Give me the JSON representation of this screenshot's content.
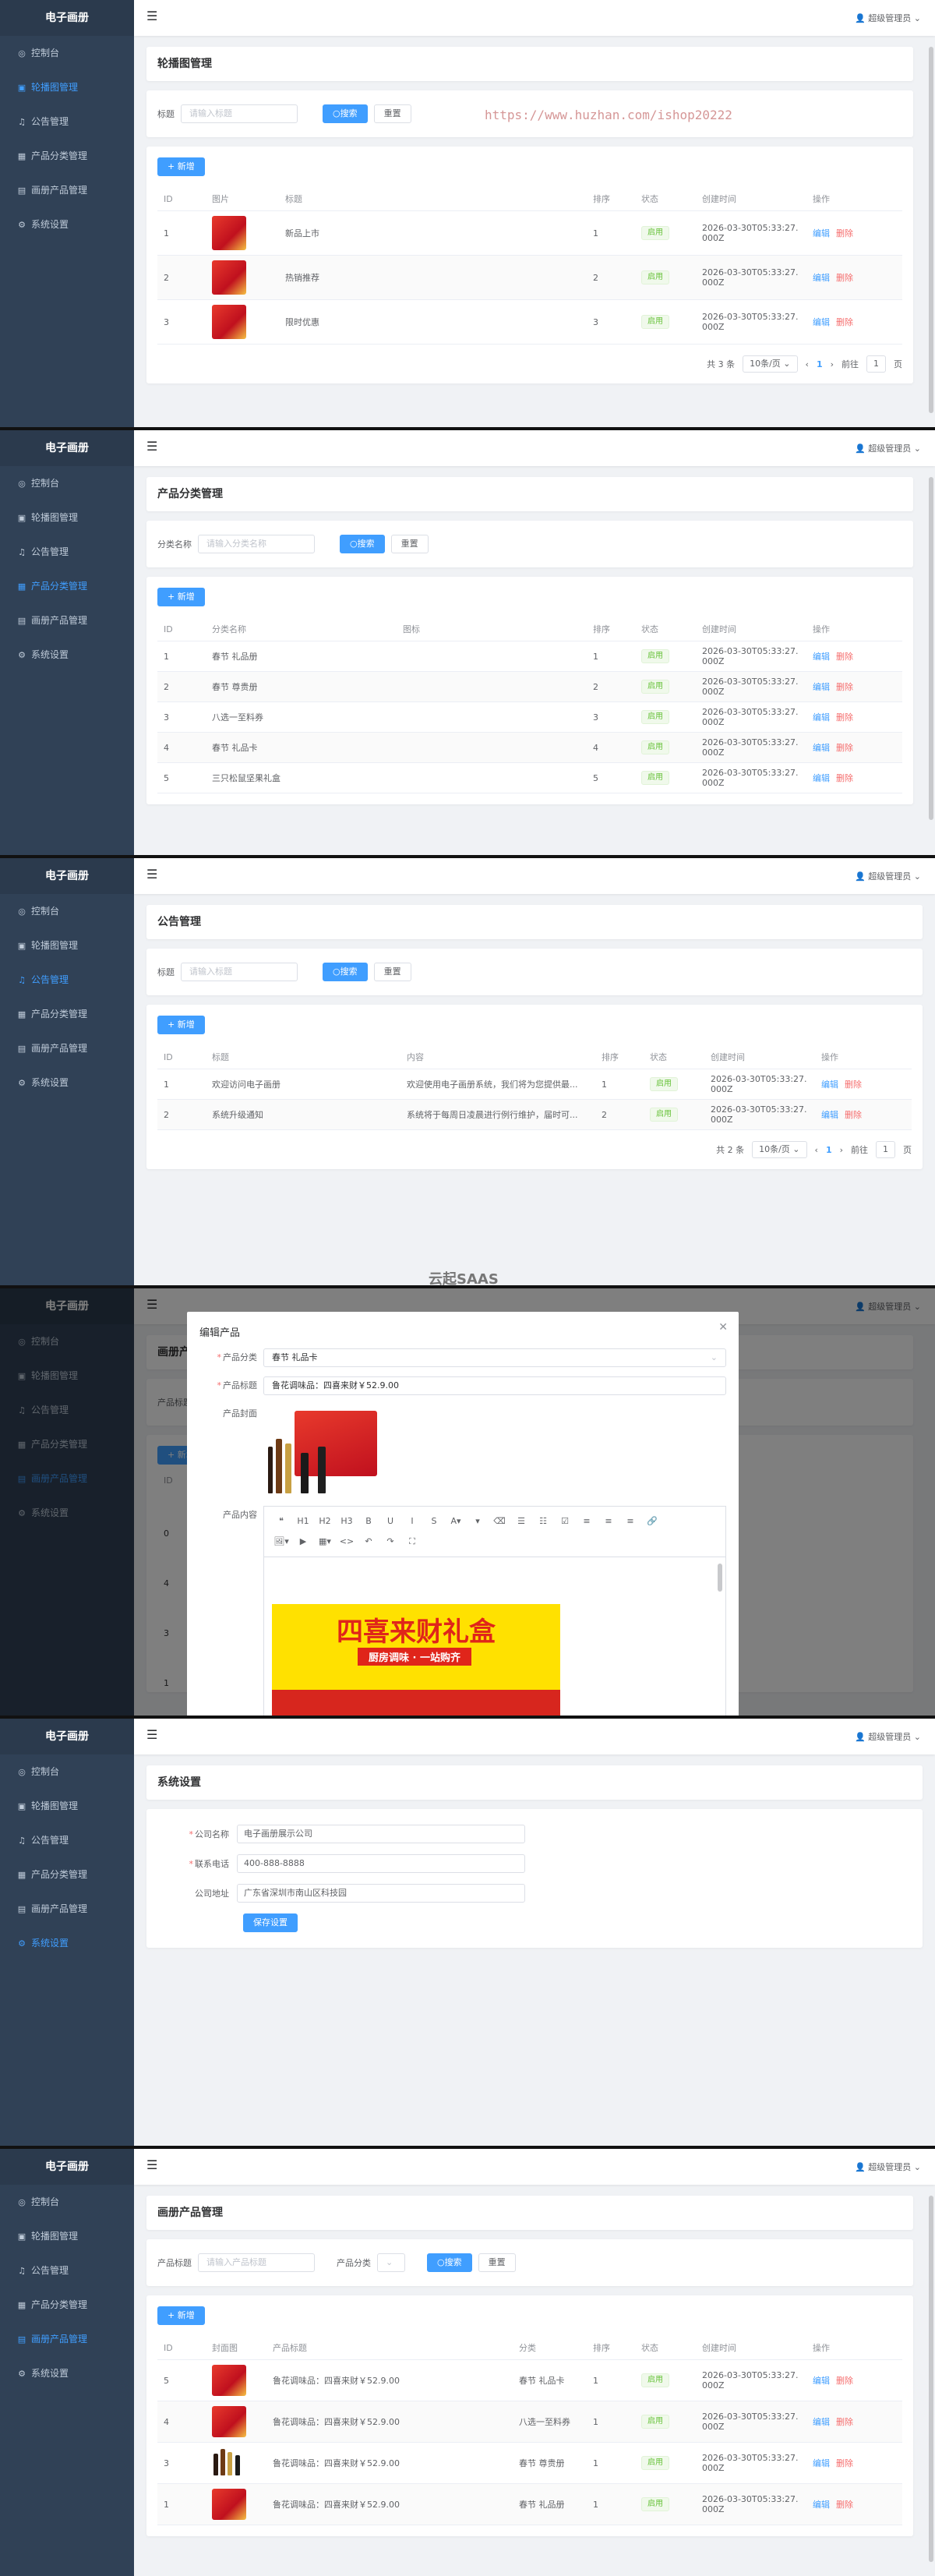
{
  "app": {
    "logo": "电子画册",
    "user": "超级管理员",
    "menu": [
      {
        "label": "控制台",
        "icon": "dashboard-icon"
      },
      {
        "label": "轮播图管理",
        "icon": "image-icon"
      },
      {
        "label": "公告管理",
        "icon": "bell-icon"
      },
      {
        "label": "产品分类管理",
        "icon": "grid-icon"
      },
      {
        "label": "画册产品管理",
        "icon": "book-icon"
      },
      {
        "label": "系统设置",
        "icon": "gear-icon"
      }
    ]
  },
  "common": {
    "search_btn": "搜索",
    "reset_btn": "重置",
    "add_btn": "+ 新增",
    "edit": "编辑",
    "delete": "删除",
    "status_enabled": "启用",
    "page_size": "10条/页",
    "goto": "前往",
    "page_unit": "页",
    "page_current": "1"
  },
  "carousel": {
    "title": "轮播图管理",
    "search_label": "标题",
    "search_placeholder": "请输入标题",
    "watermark": "https://www.huzhan.com/ishop20222",
    "columns": [
      "ID",
      "图片",
      "标题",
      "排序",
      "状态",
      "创建时间",
      "操作"
    ],
    "rows": [
      {
        "id": "1",
        "title": "新品上市",
        "sort": "1",
        "time": "2026-03-30T05:33:27.000Z"
      },
      {
        "id": "2",
        "title": "热销推荐",
        "sort": "2",
        "time": "2026-03-30T05:33:27.000Z"
      },
      {
        "id": "3",
        "title": "限时优惠",
        "sort": "3",
        "time": "2026-03-30T05:33:27.000Z"
      }
    ],
    "total": "共 3 条"
  },
  "category": {
    "title": "产品分类管理",
    "search_label": "分类名称",
    "search_placeholder": "请输入分类名称",
    "columns": [
      "ID",
      "分类名称",
      "图标",
      "排序",
      "状态",
      "创建时间",
      "操作"
    ],
    "rows": [
      {
        "id": "1",
        "name": "春节 礼品册",
        "sort": "1",
        "time": "2026-03-30T05:33:27.000Z"
      },
      {
        "id": "2",
        "name": "春节 尊贵册",
        "sort": "2",
        "time": "2026-03-30T05:33:27.000Z"
      },
      {
        "id": "3",
        "name": "八选一至料券",
        "sort": "3",
        "time": "2026-03-30T05:33:27.000Z"
      },
      {
        "id": "4",
        "name": "春节 礼品卡",
        "sort": "4",
        "time": "2026-03-30T05:33:27.000Z"
      },
      {
        "id": "5",
        "name": "三只松鼠坚果礼盒",
        "sort": "5",
        "time": "2026-03-30T05:33:27.000Z"
      }
    ]
  },
  "notice": {
    "title": "公告管理",
    "search_label": "标题",
    "search_placeholder": "请输入标题",
    "columns": [
      "ID",
      "标题",
      "内容",
      "排序",
      "状态",
      "创建时间",
      "操作"
    ],
    "rows": [
      {
        "id": "1",
        "title": "欢迎访问电子画册",
        "content": "欢迎使用电子画册系统，我们将为您提供最...",
        "sort": "1",
        "time": "2026-03-30T05:33:27.000Z"
      },
      {
        "id": "2",
        "title": "系统升级通知",
        "content": "系统将于每周日凌晨进行例行维护，届时可...",
        "sort": "2",
        "time": "2026-03-30T05:33:27.000Z"
      }
    ],
    "total": "共 2 条",
    "watermark": "云起SAAS"
  },
  "edit_dialog": {
    "title": "编辑产品",
    "category_label": "产品分类",
    "category_value": "春节 礼品卡",
    "title_label": "产品标题",
    "title_value": "鲁花调味品：四喜来财￥52.9.00",
    "cover_label": "产品封面",
    "content_label": "产品内容",
    "toolbar_row1": [
      "❝",
      "H1",
      "H2",
      "H3",
      "B",
      "U",
      "I",
      "S",
      "A▾",
      "▾",
      "⌫",
      "☰",
      "☷",
      "☑",
      "≡",
      "≡",
      "≡",
      "🔗"
    ],
    "toolbar_row2": [
      "🖼▾",
      "▶",
      "▦▾",
      "<>",
      "↶",
      "↷",
      "⛶"
    ],
    "banner_title": "四喜来财礼盒",
    "banner_sub": "厨房调味 · 一站购齐",
    "bg_ids": [
      "0",
      "4",
      "3",
      "1"
    ]
  },
  "settings": {
    "title": "系统设置",
    "company_label": "公司名称",
    "company_value": "电子画册展示公司",
    "phone_label": "联系电话",
    "phone_value": "400-888-8888",
    "address_label": "公司地址",
    "address_value": "广东省深圳市南山区科技园",
    "save_btn": "保存设置"
  },
  "products": {
    "title": "画册产品管理",
    "search_label": "产品标题",
    "search_placeholder": "请输入产品标题",
    "category_label": "产品分类",
    "columns": [
      "ID",
      "封面图",
      "产品标题",
      "分类",
      "排序",
      "状态",
      "创建时间",
      "操作"
    ],
    "rows": [
      {
        "id": "5",
        "title": "鲁花调味品：四喜来财￥52.9.00",
        "category": "春节 礼品卡",
        "sort": "1",
        "time": "2026-03-30T05:33:27.000Z"
      },
      {
        "id": "4",
        "title": "鲁花调味品：四喜来财￥52.9.00",
        "category": "八选一至料券",
        "sort": "1",
        "time": "2026-03-30T05:33:27.000Z"
      },
      {
        "id": "3",
        "title": "鲁花调味品：四喜来财￥52.9.00",
        "category": "春节 尊贵册",
        "sort": "1",
        "time": "2026-03-30T05:33:27.000Z"
      },
      {
        "id": "1",
        "title": "鲁花调味品：四喜来财￥52.9.00",
        "category": "春节 礼品册",
        "sort": "1",
        "time": "2026-03-30T05:33:27.000Z"
      }
    ]
  }
}
